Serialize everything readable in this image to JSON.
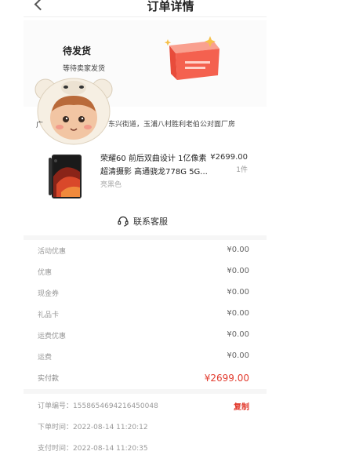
{
  "header": {
    "title": "订单详情"
  },
  "status": {
    "title": "待发货",
    "subtitle": "等待卖家发货"
  },
  "address": {
    "text": "东兴街道，玉浦八村胜利老伯公对面厂房",
    "prefix": "广"
  },
  "product": {
    "name": "荣耀60 前后双曲设计 1亿像素超清摄影 高通骁龙778G 5G...",
    "price": "¥2699.00",
    "quantity": "1件",
    "spec": "亮黑色"
  },
  "service": {
    "label": "联系客服",
    "icon": "headset-icon"
  },
  "fees": [
    {
      "label": "活动优惠",
      "value": "¥0.00"
    },
    {
      "label": "优惠",
      "value": "¥0.00"
    },
    {
      "label": "现金券",
      "value": "¥0.00"
    },
    {
      "label": "礼品卡",
      "value": "¥0.00"
    },
    {
      "label": "运费优惠",
      "value": "¥0.00"
    },
    {
      "label": "运费",
      "value": "¥0.00"
    }
  ],
  "total": {
    "label": "实付款",
    "value": "¥2699.00"
  },
  "order": {
    "number_label": "订单编号：",
    "number": "1558654694216450048",
    "copy_label": "复制",
    "time_label": "下单时间：",
    "time": "2022-08-14 11:20:12",
    "pay_label": "支付时间：",
    "pay_time": "2022-08-14 11:20:35"
  },
  "colors": {
    "accent": "#e23b2e",
    "box": "#f4614f"
  }
}
